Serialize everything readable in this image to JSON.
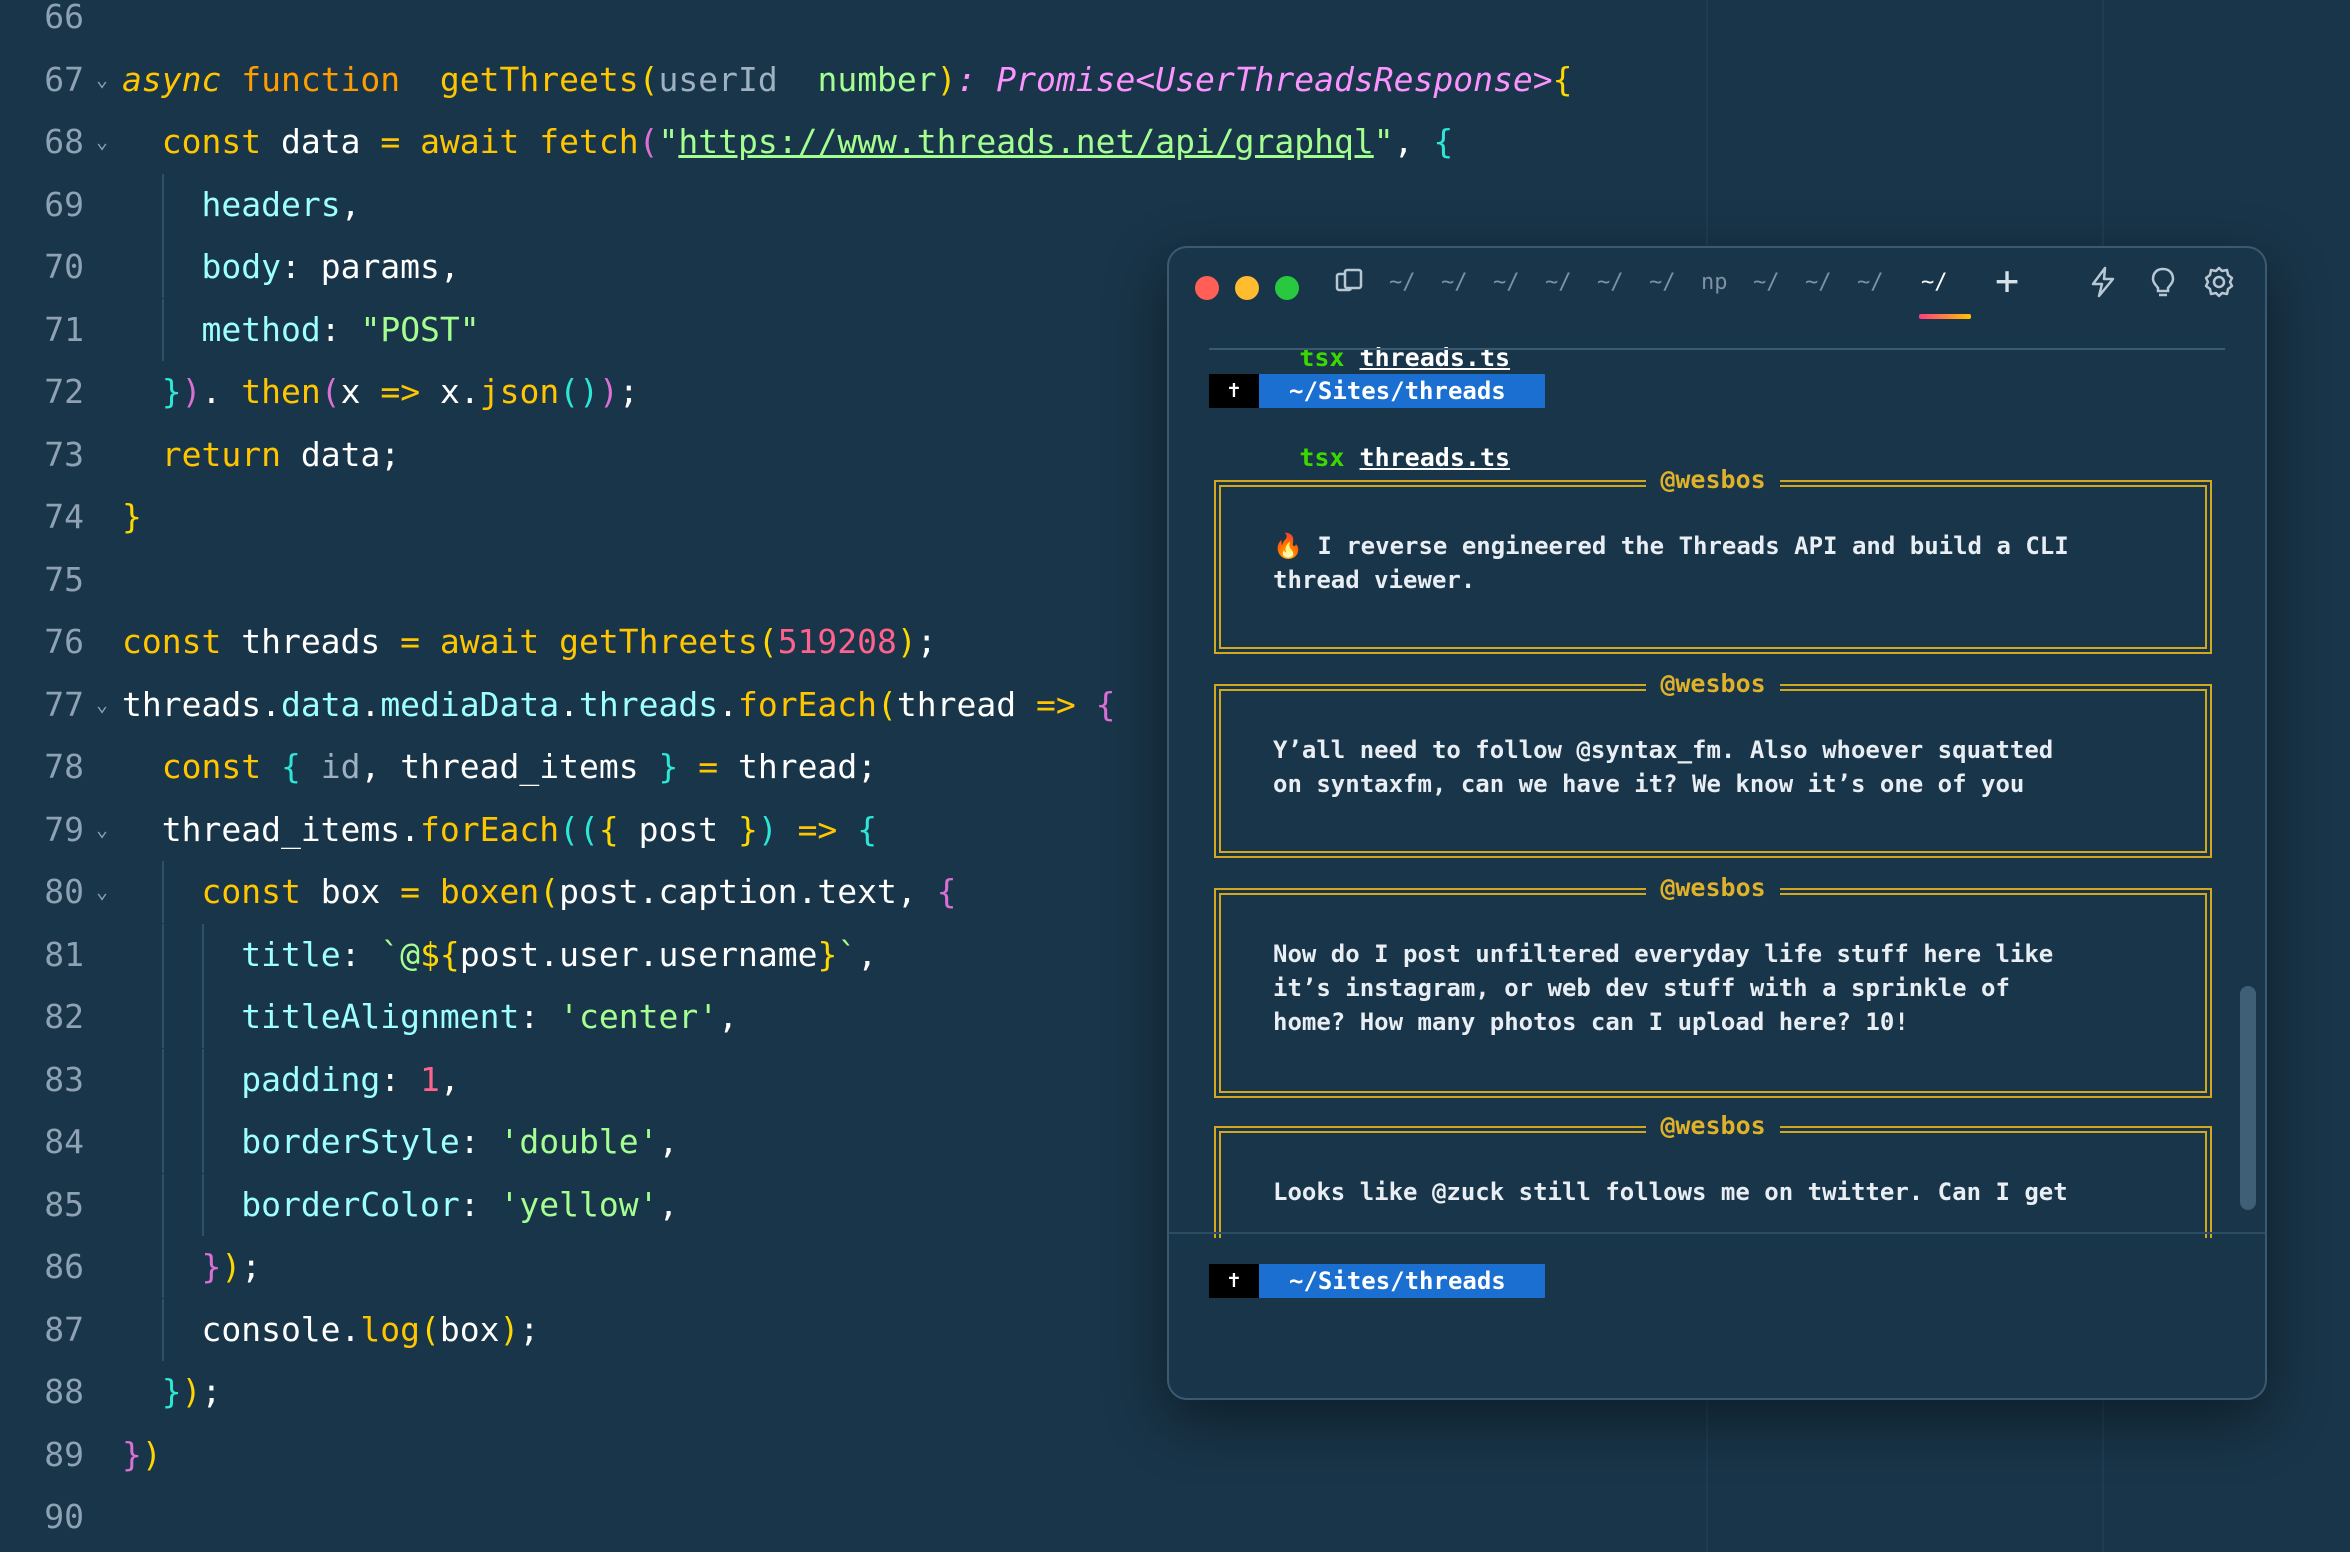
{
  "editor": {
    "lines": [
      {
        "n": "66",
        "fold": false,
        "guides": 0,
        "tokens": []
      },
      {
        "n": "67",
        "fold": true,
        "guides": 0,
        "tokens": [
          [
            "t-it",
            "async"
          ],
          [
            "",
            " "
          ],
          [
            "t-fnkw",
            "function"
          ],
          [
            "",
            "  "
          ],
          [
            "t-fn",
            "getThreets"
          ],
          [
            "b1",
            "("
          ],
          [
            "t-dim",
            "userId"
          ],
          [
            "",
            "  "
          ],
          [
            "t-pn",
            "number"
          ],
          [
            "b1",
            ")"
          ],
          [
            "t-type",
            ": Promise<UserThreadsResponse>"
          ],
          [
            "",
            ""
          ],
          [
            "b1",
            "{"
          ]
        ]
      },
      {
        "n": "68",
        "fold": true,
        "guides": 0,
        "tokens": [
          [
            "",
            "  "
          ],
          [
            "t-kw",
            "const"
          ],
          [
            "",
            " data "
          ],
          [
            "t-kw",
            "="
          ],
          [
            "",
            " "
          ],
          [
            "t-kw",
            "await"
          ],
          [
            "",
            " "
          ],
          [
            "t-fn",
            "fetch"
          ],
          [
            "b2",
            "("
          ],
          [
            "t-str",
            "\""
          ],
          [
            "t-url",
            "https://www.threads.net/api/graphql"
          ],
          [
            "t-str",
            "\""
          ],
          [
            "",
            ", "
          ],
          [
            "b3",
            "{"
          ]
        ]
      },
      {
        "n": "69",
        "fold": false,
        "guides": 1,
        "tokens": [
          [
            "",
            "    "
          ],
          [
            "t-prop",
            "headers"
          ],
          [
            "",
            ","
          ]
        ]
      },
      {
        "n": "70",
        "fold": false,
        "guides": 1,
        "tokens": [
          [
            "",
            "    "
          ],
          [
            "t-prop",
            "body"
          ],
          [
            "",
            ": params,"
          ]
        ]
      },
      {
        "n": "71",
        "fold": false,
        "guides": 1,
        "tokens": [
          [
            "",
            "    "
          ],
          [
            "t-prop",
            "method"
          ],
          [
            "",
            ": "
          ],
          [
            "t-str",
            "\"POST\""
          ]
        ]
      },
      {
        "n": "72",
        "fold": false,
        "guides": 0,
        "tokens": [
          [
            "",
            "  "
          ],
          [
            "b3",
            "}"
          ],
          [
            "b2",
            ")"
          ],
          [
            "",
            ". "
          ],
          [
            "t-fn",
            "then"
          ],
          [
            "b2",
            "("
          ],
          [
            "",
            "x "
          ],
          [
            "t-kw",
            "=>"
          ],
          [
            "",
            " x."
          ],
          [
            "t-fn",
            "json"
          ],
          [
            "b3",
            "()"
          ],
          [
            "b2",
            ")"
          ],
          [
            "",
            ";"
          ]
        ]
      },
      {
        "n": "73",
        "fold": false,
        "guides": 0,
        "tokens": [
          [
            "",
            "  "
          ],
          [
            "t-kw",
            "return"
          ],
          [
            "",
            " data;"
          ]
        ]
      },
      {
        "n": "74",
        "fold": false,
        "guides": 0,
        "tokens": [
          [
            "b1",
            "}"
          ]
        ]
      },
      {
        "n": "75",
        "fold": false,
        "guides": 0,
        "tokens": []
      },
      {
        "n": "76",
        "fold": false,
        "guides": 0,
        "tokens": [
          [
            "t-kw",
            "const"
          ],
          [
            "",
            " threads "
          ],
          [
            "t-kw",
            "="
          ],
          [
            "",
            " "
          ],
          [
            "t-kw",
            "await"
          ],
          [
            "",
            " "
          ],
          [
            "t-fn",
            "getThreets"
          ],
          [
            "b1",
            "("
          ],
          [
            "t-num",
            "519208"
          ],
          [
            "b1",
            ")"
          ],
          [
            "",
            ";"
          ]
        ]
      },
      {
        "n": "77",
        "fold": true,
        "guides": 0,
        "tokens": [
          [
            "",
            "threads."
          ],
          [
            "t-prop",
            "data"
          ],
          [
            "",
            "."
          ],
          [
            "t-prop",
            "mediaData"
          ],
          [
            "",
            "."
          ],
          [
            "t-prop",
            "threads"
          ],
          [
            "",
            "."
          ],
          [
            "t-fn",
            "forEach"
          ],
          [
            "b1",
            "("
          ],
          [
            "",
            "thread "
          ],
          [
            "t-kw",
            "=>"
          ],
          [
            "",
            " "
          ],
          [
            "b2",
            "{"
          ]
        ]
      },
      {
        "n": "78",
        "fold": false,
        "guides": 0,
        "tokens": [
          [
            "",
            "  "
          ],
          [
            "t-kw",
            "const"
          ],
          [
            "",
            " "
          ],
          [
            "b3",
            "{"
          ],
          [
            "",
            " "
          ],
          [
            "t-dim",
            "id"
          ],
          [
            "",
            ", thread_items "
          ],
          [
            "b3",
            "}"
          ],
          [
            "",
            " "
          ],
          [
            "t-kw",
            "="
          ],
          [
            "",
            " thread;"
          ]
        ]
      },
      {
        "n": "79",
        "fold": true,
        "guides": 0,
        "tokens": [
          [
            "",
            "  thread_items."
          ],
          [
            "t-fn",
            "forEach"
          ],
          [
            "b3",
            "(("
          ],
          [
            "b1",
            "{"
          ],
          [
            "",
            " post "
          ],
          [
            "b1",
            "}"
          ],
          [
            "b3",
            ")"
          ],
          [
            "",
            " "
          ],
          [
            "t-kw",
            "=>"
          ],
          [
            "",
            " "
          ],
          [
            "b3",
            "{"
          ]
        ]
      },
      {
        "n": "80",
        "fold": true,
        "guides": 1,
        "tokens": [
          [
            "",
            "    "
          ],
          [
            "t-kw",
            "const"
          ],
          [
            "",
            " box "
          ],
          [
            "t-kw",
            "="
          ],
          [
            "",
            " "
          ],
          [
            "t-fn",
            "boxen"
          ],
          [
            "b1",
            "("
          ],
          [
            "",
            "post.caption.text, "
          ],
          [
            "b2",
            "{"
          ]
        ]
      },
      {
        "n": "81",
        "fold": false,
        "guides": 2,
        "tokens": [
          [
            "",
            "      "
          ],
          [
            "t-prop",
            "title"
          ],
          [
            "",
            ": "
          ],
          [
            "t-str",
            "`@"
          ],
          [
            "b1",
            "${"
          ],
          [
            "",
            "post.user.username"
          ],
          [
            "b1",
            "}"
          ],
          [
            "t-str",
            "`"
          ],
          [
            "",
            ","
          ]
        ]
      },
      {
        "n": "82",
        "fold": false,
        "guides": 2,
        "tokens": [
          [
            "",
            "      "
          ],
          [
            "t-prop",
            "titleAlignment"
          ],
          [
            "",
            ": "
          ],
          [
            "t-str",
            "'center'"
          ],
          [
            "",
            ","
          ]
        ]
      },
      {
        "n": "83",
        "fold": false,
        "guides": 2,
        "tokens": [
          [
            "",
            "      "
          ],
          [
            "t-prop",
            "padding"
          ],
          [
            "",
            ": "
          ],
          [
            "t-num",
            "1"
          ],
          [
            "",
            ","
          ]
        ]
      },
      {
        "n": "84",
        "fold": false,
        "guides": 2,
        "tokens": [
          [
            "",
            "      "
          ],
          [
            "t-prop",
            "borderStyle"
          ],
          [
            "",
            ": "
          ],
          [
            "t-str",
            "'double'"
          ],
          [
            "",
            ","
          ]
        ]
      },
      {
        "n": "85",
        "fold": false,
        "guides": 2,
        "tokens": [
          [
            "",
            "      "
          ],
          [
            "t-prop",
            "borderColor"
          ],
          [
            "",
            ": "
          ],
          [
            "t-str",
            "'yellow'"
          ],
          [
            "",
            ","
          ]
        ]
      },
      {
        "n": "86",
        "fold": false,
        "guides": 1,
        "tokens": [
          [
            "",
            "    "
          ],
          [
            "b2",
            "}"
          ],
          [
            "b1",
            ")"
          ],
          [
            "",
            ";"
          ]
        ]
      },
      {
        "n": "87",
        "fold": false,
        "guides": 1,
        "tokens": [
          [
            "",
            "    console."
          ],
          [
            "t-fn",
            "log"
          ],
          [
            "b1",
            "("
          ],
          [
            "",
            "box"
          ],
          [
            "b1",
            ")"
          ],
          [
            "",
            ";"
          ]
        ]
      },
      {
        "n": "88",
        "fold": false,
        "guides": 0,
        "tokens": [
          [
            "",
            "  "
          ],
          [
            "b3",
            "}"
          ],
          [
            "b1",
            ")"
          ],
          [
            "",
            ";"
          ]
        ]
      },
      {
        "n": "89",
        "fold": false,
        "guides": 0,
        "tokens": [
          [
            "b2",
            "}"
          ],
          [
            "b1",
            ")"
          ]
        ]
      },
      {
        "n": "90",
        "fold": false,
        "guides": 0,
        "tokens": []
      }
    ]
  },
  "terminal": {
    "tabs": [
      "~/",
      "~/",
      "~/",
      "~/",
      "~/",
      "~/",
      "np",
      "~/",
      "~/",
      "~/",
      "~/"
    ],
    "active_tab_index": 10,
    "new_tab_label": "+",
    "command_prefix": "tsx",
    "command_file": "threads.ts",
    "prompt_symbol": "✝",
    "prompt_path": "~/Sites/threads",
    "posts": [
      {
        "title": "@wesbos",
        "text": "🔥 I reverse engineered the Threads API and build a CLI\nthread viewer."
      },
      {
        "title": "@wesbos",
        "text": "Y’all need to follow @syntax_fm. Also whoever squatted\non syntaxfm, can we have it? We know it’s one of you"
      },
      {
        "title": "@wesbos",
        "text": "Now do I post unfiltered everyday life stuff here like\nit’s instagram, or web dev stuff with a sprinkle of\nhome? How many photos can I upload here? 10!"
      },
      {
        "title": "@wesbos",
        "text": "Looks like @zuck still follows me on twitter. Can I get"
      }
    ],
    "icons": [
      "split-pane-icon",
      "lightning-icon",
      "lightbulb-icon",
      "gear-icon"
    ]
  },
  "colors": {
    "background": "#193549",
    "box_border": "#d4a81e",
    "prompt_blue": "#1a6fd0",
    "tsx_green": "#3ad900"
  }
}
